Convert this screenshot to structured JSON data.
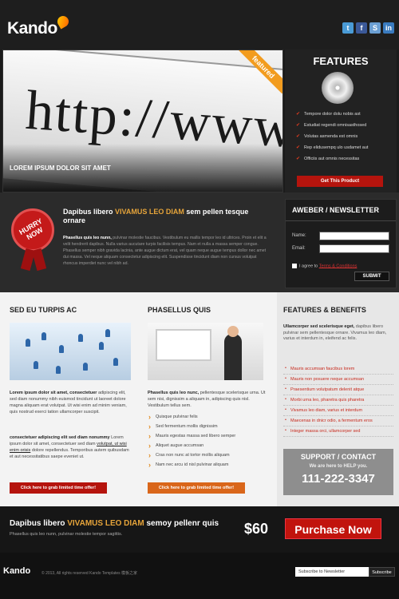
{
  "brand": {
    "name": "Kando"
  },
  "social": [
    {
      "icon": "twitter-icon",
      "glyph": "t",
      "color": "#4a9bd6"
    },
    {
      "icon": "facebook-icon",
      "glyph": "f",
      "color": "#3b5998"
    },
    {
      "icon": "share-icon",
      "glyph": "S",
      "color": "#6b9fd3"
    },
    {
      "icon": "linkedin-icon",
      "glyph": "in",
      "color": "#3a7bbf"
    }
  ],
  "hero": {
    "url_text": "http://www.",
    "ribbon": "featured",
    "caption": "LOREM IPSUM DOLOR SIT AMET"
  },
  "features": {
    "title": "FEATURES",
    "items": [
      "Tempore dolor dolu nobis ast",
      "Estudiat regendi omnisasthosed",
      "Volutas asmenda est omnis",
      "Rep elidusempq ulo usdamet aut",
      "Officiis aut omnis necessitas"
    ],
    "button": "Get This Product"
  },
  "promo": {
    "badge": "HURRY NOW",
    "title_pre": "Dapibus libero ",
    "title_hl": "VIVAMUS LEO DIAM",
    "title_post": " sem pellen tesque ornare",
    "body_bold": "Phasellus quis leo nunn,",
    "body": " pulvinar molestie faucibus. Vestibulum eu mallis tempor leo id ultrices. Proin et elit a velit hendrerit dapibus. Nulla varius aucutare turpis facilisis tempus. Nam et nulla a massa semper congue. Phasellus semper nibh gravida lacinia, ante augue dictum erat, vel quam neque augue tempus dollor nec amet dui massa. Vel neque aliquam consectetur adipiscing elit. Suspendisse tincidunt diam non cursus volutpat rhoncus imperdiet nunc vel nibh ad."
  },
  "aweber": {
    "title": "AWEBER / NEWSLETTER",
    "name_label": "Name:",
    "email_label": "Email:",
    "agree_text": "I agree to",
    "agree_link": "Terms & Conditions",
    "submit": "SUBMIT"
  },
  "col1": {
    "title": "SED EU TURPIS AC",
    "p1_bold": "Lorem ipsum dolor sit amet, consectetuer",
    "p1": " adipiscing elit, sed diam nonummy nibh euismod tincidunt ut laoreet dolore magna aliquam erat volutpat. Ut wisi enim ad minim veniam, quis nostrud exerci tation ullamcorper suscipit.",
    "p2_bold": "consectetuer adipiscing elit sed diam nonummy",
    "p2": " Lorem ipsum dolor sit amet, consectetuer sed diam ",
    "p2_link": "volutpat, ut wisi enim orisis",
    "p2_end": " dolore repellendus. Temporibus autem quibusdam et aut necessitatibus saepe eveniet ut.",
    "button": "Click here to grab limited time offer!"
  },
  "col2": {
    "title": "PHASELLUS QUIS",
    "p_bold": "Phasellus quis leo nunc,",
    "p": " pellentesque scelerisque urna. Ut sem nisi, dignissim a aliquam in, adipiscing quis nisl. Vestibulum tellus sem.",
    "items": [
      "Quisque pulvinar felis",
      "Sed fermentum mollis dignissim",
      "Mauris egestas massa sed libero semper",
      "Aliquet augue accumsan",
      "Cras non nunc at tortor mollis aliquam",
      "Nam nec arcu id nisl pulvinar aliquam"
    ],
    "button": "Click here to grab limited time offer!"
  },
  "col3": {
    "title": "FEATURES & BENEFITS",
    "intro_bold": "Ullamcorper sed scelerisque eget,",
    "intro": " dapibus libero pulvinar sem pellentesque ornare. Vivamus leo diam, varius et interdum in, eleifend ac felis.",
    "items": [
      "Mauris accumsan faucibus lorem",
      "Mauris non posuere neque accumsan",
      "Praesentium volutpatum delenit atque",
      "Morbi urna leo, pharetra quis pharetra",
      "Vivamus leo diam, varius et interdum",
      "Maecenas in dnicr odio, a fermentum eros",
      "Integer massa orci, ullamcorper sed"
    ],
    "support_title": "SUPPORT / CONTACT",
    "support_sub": "We are here to HELP you.",
    "phone": "111-222-3347"
  },
  "band": {
    "title_pre": "Dapibus libero ",
    "title_hl": "VIVAMUS LEO DIAM",
    "title_post": " semoy pellenr quis",
    "sub": "Phasellus quis leo nunn, pulvinar molestie tempor sagittis.",
    "price": "$60",
    "button": "Purchase Now"
  },
  "footer": {
    "logo": "Kando",
    "copyright": "© 2013, All rights reserved Kando Templates 模板之家",
    "subscribe_placeholder": "Subscribe to Newsletter",
    "subscribe_button": "Subscribe"
  }
}
